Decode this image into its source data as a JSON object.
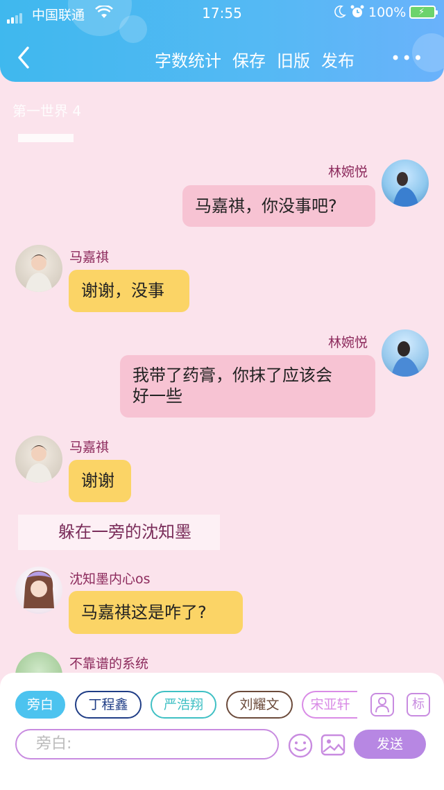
{
  "status_bar": {
    "carrier": "中国联通",
    "time": "17:55",
    "battery": "100%"
  },
  "nav": {
    "items": [
      "字数统计",
      "保存",
      "旧版",
      "发布"
    ],
    "more": "•••"
  },
  "scene_title": "第一世界 4",
  "messages": [
    {
      "name": "林婉悦",
      "text": "马嘉祺，你没事吧?"
    },
    {
      "name": "马嘉祺",
      "text": "谢谢，没事"
    },
    {
      "name": "林婉悦",
      "text_line1": "我带了药膏，你抹了应该会",
      "text_line2": "好一些"
    },
    {
      "name": "马嘉祺",
      "text": "谢谢"
    },
    {
      "narration": "躲在一旁的沈知墨"
    },
    {
      "name": "沈知墨内心os",
      "text": "马嘉祺这是咋了?"
    },
    {
      "name": "不靠谱的系统"
    }
  ],
  "composer": {
    "roles": [
      "旁白",
      "丁程鑫",
      "严浩翔",
      "刘耀文",
      "宋亚轩"
    ],
    "tag_button": "标",
    "input_placeholder": "旁白:",
    "send_label": "发送"
  },
  "colors": {
    "header_blue": "#3fb8ee",
    "background_pink": "#fbe3ec",
    "bubble_pink": "#f7c3d3",
    "bubble_yellow": "#fbd466",
    "name_color": "#8c2a5c",
    "send_purple": "#b787e3",
    "chip_narrator": "#4cc3ef",
    "chip_ding": "#1f3d86",
    "chip_yan": "#3fc0c4",
    "chip_liu": "#6b4a3a",
    "chip_song": "#d98be6"
  }
}
